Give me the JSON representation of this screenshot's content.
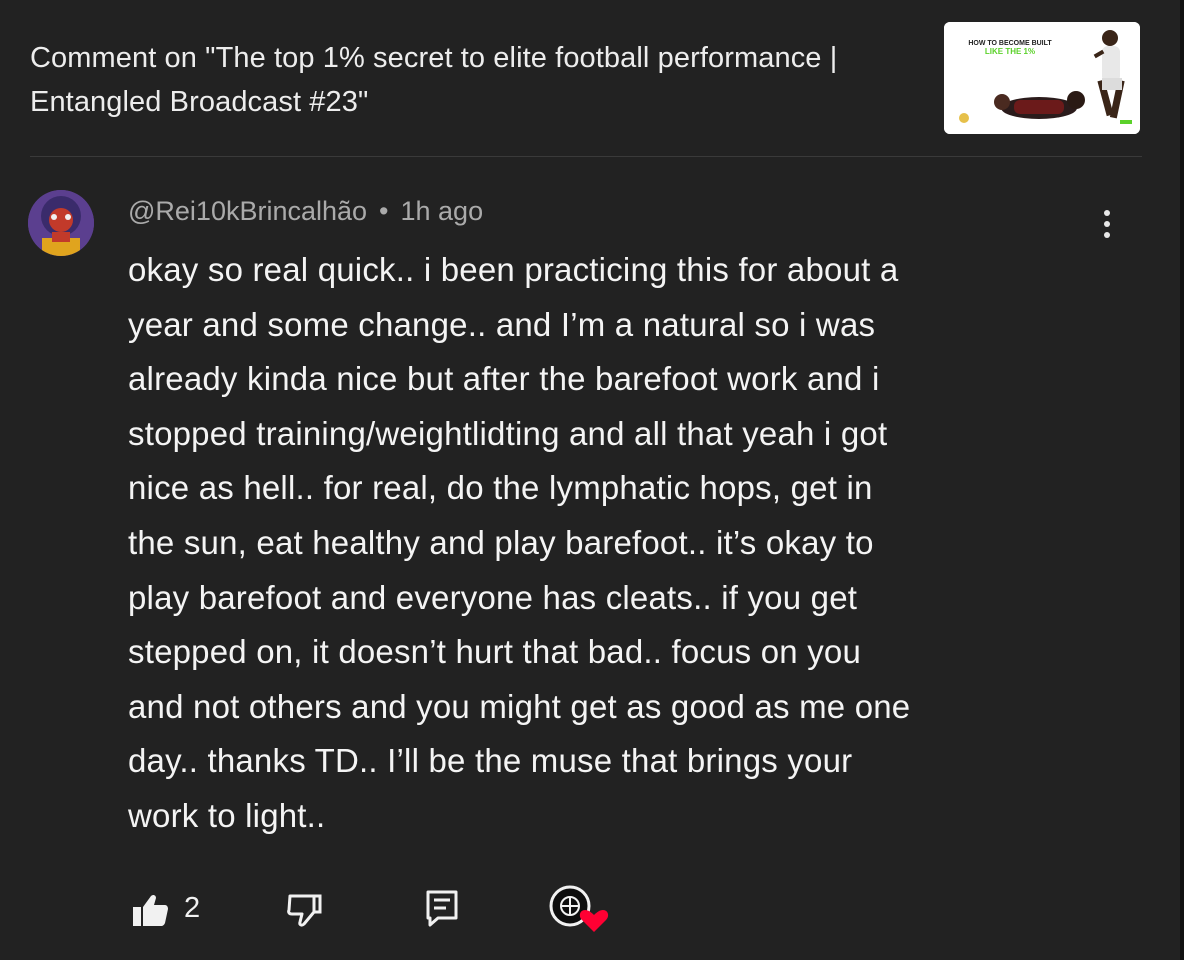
{
  "header": {
    "title": "Comment on \"The top 1% secret to elite football performance | Entangled Broadcast #23\""
  },
  "thumbnail": {
    "line1": "HOW TO BECOME BUILT",
    "line2": "LIKE THE 1%",
    "accent": "#5bd12a"
  },
  "comment": {
    "author": "@Rei10kBrincalhão",
    "separator": "•",
    "time": "1h ago",
    "text": "okay so real quick.. i been practicing this for about a\nyear and some change.. and I’m a natural so i was\nalready kinda nice but after the barefoot work and i\nstopped training/weightlidting and all that yeah i got\nnice as hell.. for real, do the lymphatic hops, get in\nthe sun, eat healthy and play barefoot.. it’s okay to\nplay barefoot and everyone has cleats.. if you get\nstepped on, it doesn’t hurt that bad.. focus on you\nand not others and you might get as good as me one\nday.. thanks TD.. I’ll be the muse that brings your\nwork to light..",
    "like_count": "2"
  },
  "icons": {
    "like": "thumbs-up-icon",
    "dislike": "thumbs-down-icon",
    "reply": "reply-icon",
    "creator_heart": "creator-heart-icon",
    "more": "more-vert-icon"
  },
  "colors": {
    "background": "#222222",
    "text": "#f1f1f1",
    "secondary_text": "#aaaaaa",
    "heart": "#ff0033"
  }
}
